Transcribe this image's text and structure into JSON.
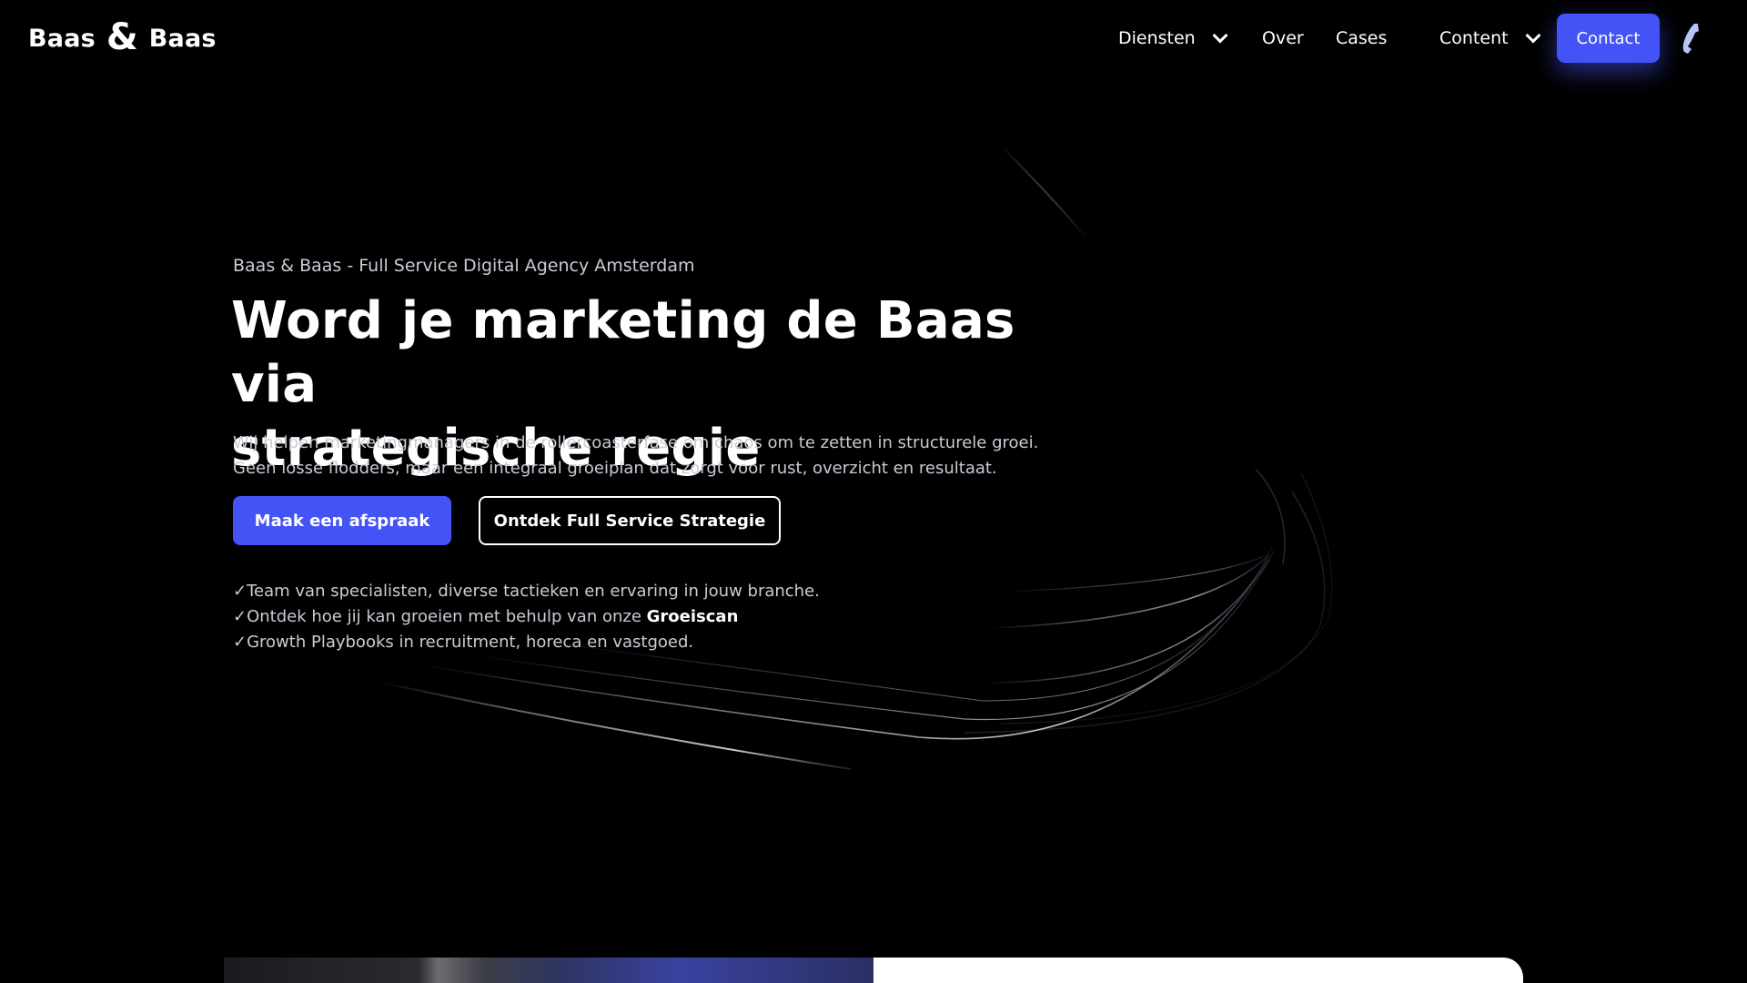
{
  "header": {
    "logo": {
      "word_left": "Baas",
      "ampersand": "&",
      "word_right": "Baas"
    },
    "nav": {
      "items": [
        {
          "label": "Diensten",
          "dropdown": true
        },
        {
          "label": "Over",
          "dropdown": false
        },
        {
          "label": "Cases",
          "dropdown": false
        },
        {
          "label": "Content",
          "dropdown": true
        }
      ],
      "contact_label": "Contact",
      "phone_icon": "phone-icon"
    }
  },
  "hero": {
    "eyebrow": "Baas & Baas - Full Service Digital Agency Amsterdam",
    "title_line1": "Word je marketing de Baas via",
    "title_line2": "strategische regie",
    "subtitle_line1": "Wij helpen marketingmanagers in de rollercoasterfase om chaos om te zetten in structurele groei.",
    "subtitle_line2": "Geen losse flodders, maar een integraal groeiplan dat zorgt voor rust, overzicht en resultaat.",
    "primary_cta": "Maak een afspraak",
    "secondary_cta": "Ontdek Full Service Strategie",
    "checks": [
      {
        "mark": "✓",
        "text": "Team van specialisten, diverse tactieken en ervaring in jouw branche.",
        "bold": ""
      },
      {
        "mark": "✓",
        "text": "Ontdek hoe jij kan groeien met behulp van onze ",
        "bold": "Groeiscan"
      },
      {
        "mark": "✓",
        "text": "Growth Playbooks in recruitment, horeca en vastgoed.",
        "bold": ""
      }
    ]
  },
  "colors": {
    "background": "#000000",
    "accent": "#4353f5",
    "text": "#ffffff",
    "muted_text": "#c9ccd6"
  }
}
